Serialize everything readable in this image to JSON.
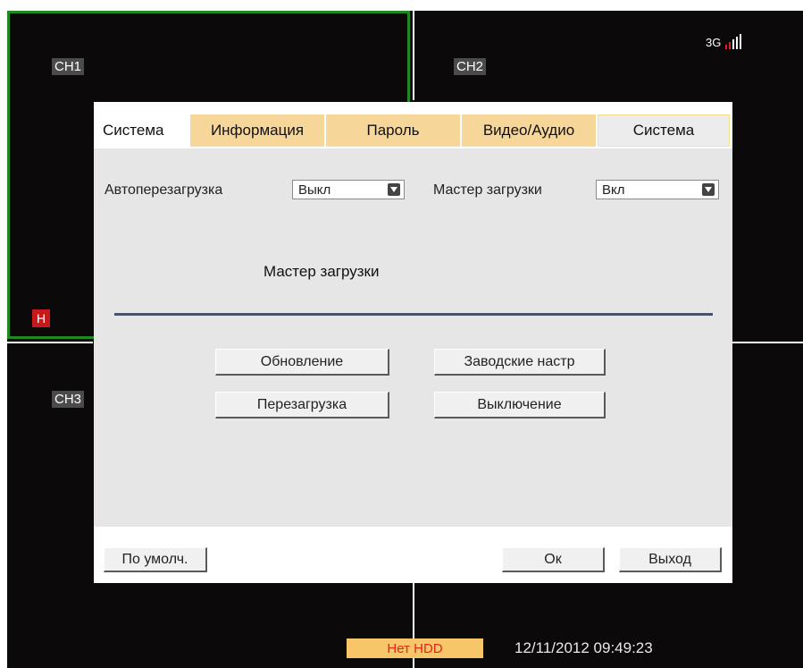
{
  "channels": {
    "ch1": "CH1",
    "ch2": "CH2",
    "ch3": "CH3",
    "h_badge": "H"
  },
  "signal": {
    "label": "3G",
    "bars": 5
  },
  "tabs": [
    {
      "label": "Система",
      "style": "plain"
    },
    {
      "label": "Информация",
      "style": "orange"
    },
    {
      "label": "Пароль",
      "style": "orange"
    },
    {
      "label": "Видео/Аудио",
      "style": "orange"
    },
    {
      "label": "Система",
      "style": "active"
    }
  ],
  "settings": {
    "autoreboot_label": "Автоперезагрузка",
    "autoreboot_value": "Выкл",
    "wizard_label": "Мастер загрузки",
    "wizard_value": "Вкл"
  },
  "section_title": "Мастер загрузки",
  "actions": {
    "update": "Обновление",
    "factory": "Заводские настр",
    "reboot": "Перезагрузка",
    "shutdown": "Выключение"
  },
  "footer": {
    "defaults": "По умолч.",
    "ok": "Ок",
    "exit": "Выход"
  },
  "status": {
    "hdd": "Нет HDD",
    "datetime": "12/11/2012 09:49:23"
  },
  "colors": {
    "active_frame": "#1f8a1f",
    "tab_orange": "#f7d69a",
    "hdd_bg": "#f6c668",
    "hdd_text": "#e0281a"
  }
}
